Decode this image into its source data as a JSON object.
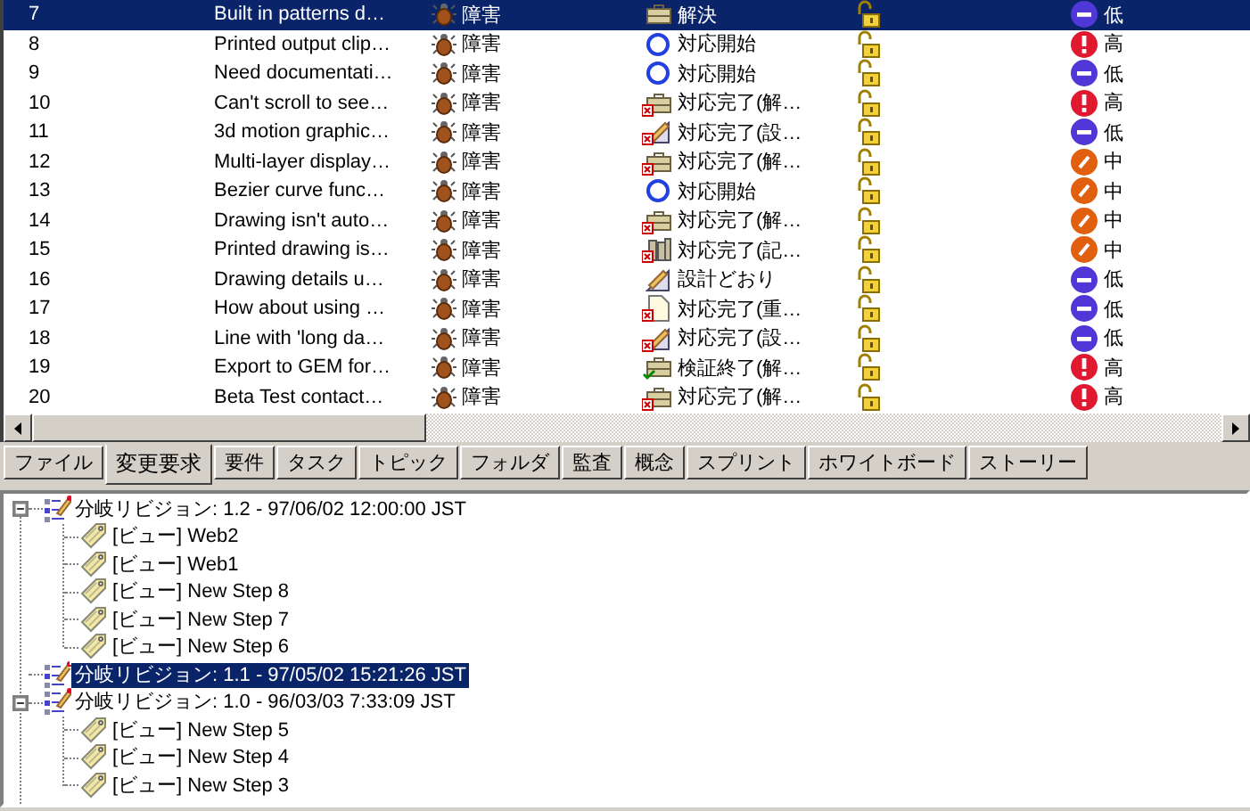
{
  "table": {
    "rows": [
      {
        "number": "7",
        "title": "Built in patterns d…",
        "type": "障害",
        "status": {
          "kind": "resolved",
          "label": "解決"
        },
        "priority": {
          "kind": "low",
          "label": "低"
        },
        "selected": true
      },
      {
        "number": "8",
        "title": "Printed output clip…",
        "type": "障害",
        "status": {
          "kind": "open",
          "label": "対応開始"
        },
        "priority": {
          "kind": "high",
          "label": "高"
        },
        "selected": false
      },
      {
        "number": "9",
        "title": "Need documentati…",
        "type": "障害",
        "status": {
          "kind": "open",
          "label": "対応開始"
        },
        "priority": {
          "kind": "low",
          "label": "低"
        },
        "selected": false
      },
      {
        "number": "10",
        "title": "Can't scroll to see…",
        "type": "障害",
        "status": {
          "kind": "fixed",
          "label": "対応完了(解…"
        },
        "priority": {
          "kind": "high",
          "label": "高"
        },
        "selected": false
      },
      {
        "number": "11",
        "title": "3d motion graphic…",
        "type": "障害",
        "status": {
          "kind": "design-closed",
          "label": "対応完了(設…"
        },
        "priority": {
          "kind": "low",
          "label": "低"
        },
        "selected": false
      },
      {
        "number": "12",
        "title": "Multi-layer display…",
        "type": "障害",
        "status": {
          "kind": "fixed",
          "label": "対応完了(解…"
        },
        "priority": {
          "kind": "medium",
          "label": "中"
        },
        "selected": false
      },
      {
        "number": "13",
        "title": "Bezier curve func…",
        "type": "障害",
        "status": {
          "kind": "open",
          "label": "対応開始"
        },
        "priority": {
          "kind": "medium",
          "label": "中"
        },
        "selected": false
      },
      {
        "number": "14",
        "title": "Drawing isn't auto…",
        "type": "障害",
        "status": {
          "kind": "fixed",
          "label": "対応完了(解…"
        },
        "priority": {
          "kind": "medium",
          "label": "中"
        },
        "selected": false
      },
      {
        "number": "15",
        "title": "Printed drawing is…",
        "type": "障害",
        "status": {
          "kind": "doc-closed",
          "label": "対応完了(記…"
        },
        "priority": {
          "kind": "medium",
          "label": "中"
        },
        "selected": false
      },
      {
        "number": "16",
        "title": "Drawing details u…",
        "type": "障害",
        "status": {
          "kind": "as-designed",
          "label": "設計どおり"
        },
        "priority": {
          "kind": "low",
          "label": "低"
        },
        "selected": false
      },
      {
        "number": "17",
        "title": "How about using …",
        "type": "障害",
        "status": {
          "kind": "duplicate",
          "label": "対応完了(重…"
        },
        "priority": {
          "kind": "low",
          "label": "低"
        },
        "selected": false
      },
      {
        "number": "18",
        "title": "Line with 'long da…",
        "type": "障害",
        "status": {
          "kind": "design-closed",
          "label": "対応完了(設…"
        },
        "priority": {
          "kind": "low",
          "label": "低"
        },
        "selected": false
      },
      {
        "number": "19",
        "title": "Export to GEM for…",
        "type": "障害",
        "status": {
          "kind": "verified",
          "label": "検証終了(解…"
        },
        "priority": {
          "kind": "high",
          "label": "高"
        },
        "selected": false
      },
      {
        "number": "20",
        "title": "Beta Test contact…",
        "type": "障害",
        "status": {
          "kind": "fixed",
          "label": "対応完了(解…"
        },
        "priority": {
          "kind": "high",
          "label": "高"
        },
        "selected": false
      }
    ]
  },
  "tabs": [
    {
      "label": "ファイル",
      "selected": false
    },
    {
      "label": "変更要求",
      "selected": true
    },
    {
      "label": "要件",
      "selected": false
    },
    {
      "label": "タスク",
      "selected": false
    },
    {
      "label": "トピック",
      "selected": false
    },
    {
      "label": "フォルダ",
      "selected": false
    },
    {
      "label": "監査",
      "selected": false
    },
    {
      "label": "概念",
      "selected": false
    },
    {
      "label": "スプリント",
      "selected": false
    },
    {
      "label": "ホワイトボード",
      "selected": false
    },
    {
      "label": "ストーリー",
      "selected": false
    }
  ],
  "tree": [
    {
      "label": "分岐リビジョン: 1.2 - 97/06/02 12:00:00 JST",
      "selected": false,
      "expanded": true,
      "children": [
        {
          "label": "[ビュー] Web2",
          "selected": false
        },
        {
          "label": "[ビュー] Web1",
          "selected": false
        },
        {
          "label": "[ビュー] New Step 8",
          "selected": false
        },
        {
          "label": "[ビュー] New Step 7",
          "selected": false
        },
        {
          "label": "[ビュー] New Step 6",
          "selected": false
        }
      ]
    },
    {
      "label": "分岐リビジョン: 1.1 - 97/05/02 15:21:26 JST",
      "selected": true
    },
    {
      "label": "分岐リビジョン: 1.0 - 96/03/03 7:33:09 JST",
      "selected": false,
      "expanded": true,
      "children": [
        {
          "label": "[ビュー] New Step 5",
          "selected": false
        },
        {
          "label": "[ビュー] New Step 4",
          "selected": false
        },
        {
          "label": "[ビュー] New Step 3",
          "selected": false
        }
      ]
    }
  ]
}
